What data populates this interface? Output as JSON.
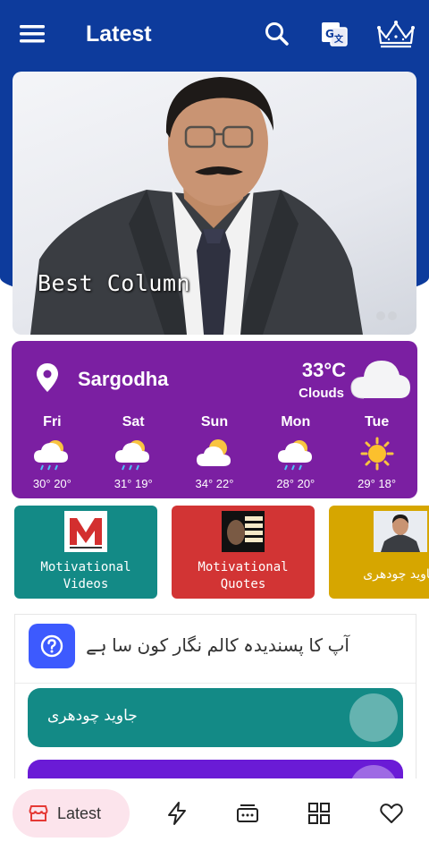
{
  "appbar": {
    "title": "Latest",
    "icons": [
      "menu-icon",
      "search-icon",
      "translate-icon",
      "crown-icon"
    ]
  },
  "hero": {
    "label": "Best Column",
    "dots": 2
  },
  "weather": {
    "city": "Sargodha",
    "temp": "33°C",
    "condition": "Clouds",
    "days": [
      {
        "name": "Fri",
        "icon": "rain-sun-icon",
        "temps": "30°   20°"
      },
      {
        "name": "Sat",
        "icon": "rain-sun-icon",
        "temps": "31°   19°"
      },
      {
        "name": "Sun",
        "icon": "sun-cloud-icon",
        "temps": "34°   22°"
      },
      {
        "name": "Mon",
        "icon": "rain-sun-icon",
        "temps": "28°   20°"
      },
      {
        "name": "Tue",
        "icon": "sun-icon",
        "temps": "29°   18°"
      }
    ]
  },
  "cards": [
    {
      "label": "Motivational Videos",
      "color": "#138a86"
    },
    {
      "label": "Motivational Quotes",
      "color": "#d23434"
    },
    {
      "label": "جاوید چودھری",
      "color": "#d6a600"
    }
  ],
  "poll": {
    "question": "آپ کا پسندیدہ کالم نگار کون سا ہے",
    "options": [
      {
        "label": "جاوید چودھری",
        "color": "#138a86"
      },
      {
        "label": "",
        "color": "#6a1bd6"
      }
    ]
  },
  "bottomnav": {
    "active_label": "Latest",
    "items": [
      "store-icon",
      "bolt-icon",
      "category-icon",
      "grid-icon",
      "heart-icon"
    ]
  },
  "colors": {
    "primary": "#0d3b9c",
    "weather_bg": "#7b1fa2",
    "nav_active_bg": "#fce4ec"
  }
}
